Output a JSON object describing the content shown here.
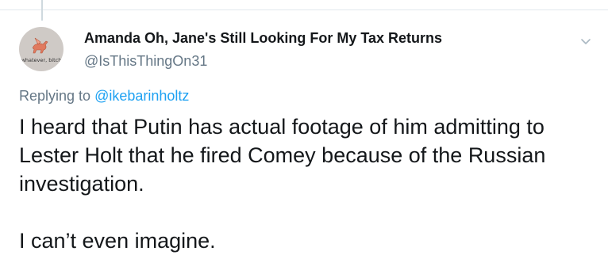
{
  "tweet": {
    "display_name": "Amanda Oh, Jane's Still Looking For My Tax Returns",
    "handle": "@IsThisThingOn31",
    "avatar_text": "whatever, bitch",
    "replying_prefix": "Replying to",
    "replying_to": "@ikebarinholtz",
    "paragraphs": [
      "I heard that Putin has actual footage of him admitting to Lester Holt that he fired Comey because of the Russian investigation.",
      "I can’t even imagine."
    ]
  },
  "colors": {
    "text": "#14171a",
    "secondary": "#657786",
    "link": "#1da1f2",
    "border": "#e1e8ed"
  },
  "icons": {
    "menu": "chevron-down-icon",
    "avatar_art": "pegasus-icon"
  }
}
